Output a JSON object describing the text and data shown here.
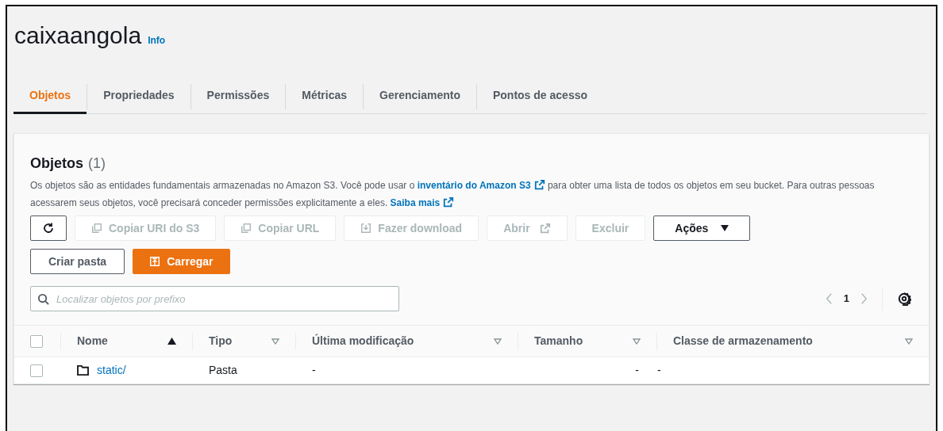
{
  "header": {
    "title": "caixaangola",
    "info": "Info"
  },
  "tabs": [
    {
      "label": "Objetos",
      "selected": true
    },
    {
      "label": "Propriedades",
      "selected": false
    },
    {
      "label": "Permissões",
      "selected": false
    },
    {
      "label": "Métricas",
      "selected": false
    },
    {
      "label": "Gerenciamento",
      "selected": false
    },
    {
      "label": "Pontos de acesso",
      "selected": false
    }
  ],
  "panel": {
    "title": "Objetos",
    "count": "(1)",
    "description": [
      {
        "kind": "text",
        "text": "Os objetos são as entidades fundamentais armazenadas no Amazon S3. Você pode usar o "
      },
      {
        "kind": "link",
        "text": "inventário do Amazon S3"
      },
      {
        "kind": "text",
        "text": " para obter uma lista de todos os objetos em seu bucket. Para outras pessoas acessarem seus objetos, você precisará conceder permissões explicitamente a eles. "
      },
      {
        "kind": "link",
        "text": "Saiba mais"
      }
    ],
    "toolbar": [
      {
        "kind": "refresh",
        "disabled": false
      },
      {
        "kind": "copy",
        "label": "Copiar URI do S3",
        "disabled": true
      },
      {
        "kind": "copy",
        "label": "Copiar URL",
        "disabled": true
      },
      {
        "kind": "download",
        "label": "Fazer download",
        "disabled": true
      },
      {
        "kind": "external",
        "label": "Abrir",
        "disabled": true
      },
      {
        "kind": "plain",
        "label": "Excluir",
        "disabled": true
      },
      {
        "kind": "dropdown",
        "label": "Ações",
        "disabled": false
      }
    ],
    "actions": [
      {
        "kind": "plain",
        "label": "Criar pasta"
      },
      {
        "kind": "primary",
        "label": "Carregar"
      }
    ],
    "search": {
      "placeholder": "Localizar objetos por prefixo"
    },
    "pagination": {
      "page": "1",
      "prev_disabled": true,
      "next_disabled": true
    },
    "table": {
      "select_all": false,
      "columns": [
        {
          "label": "Nome",
          "sorted": true
        },
        {
          "label": "Tipo",
          "sorted": false
        },
        {
          "label": "Última modificação",
          "sorted": false
        },
        {
          "label": "Tamanho",
          "sorted": false
        },
        {
          "label": "Classe de armazenamento",
          "sorted": false
        }
      ],
      "rows": [
        {
          "checked": false,
          "name": "static/",
          "type": "Pasta",
          "modified": "-",
          "size": "-",
          "storage_class": "-"
        }
      ]
    }
  }
}
